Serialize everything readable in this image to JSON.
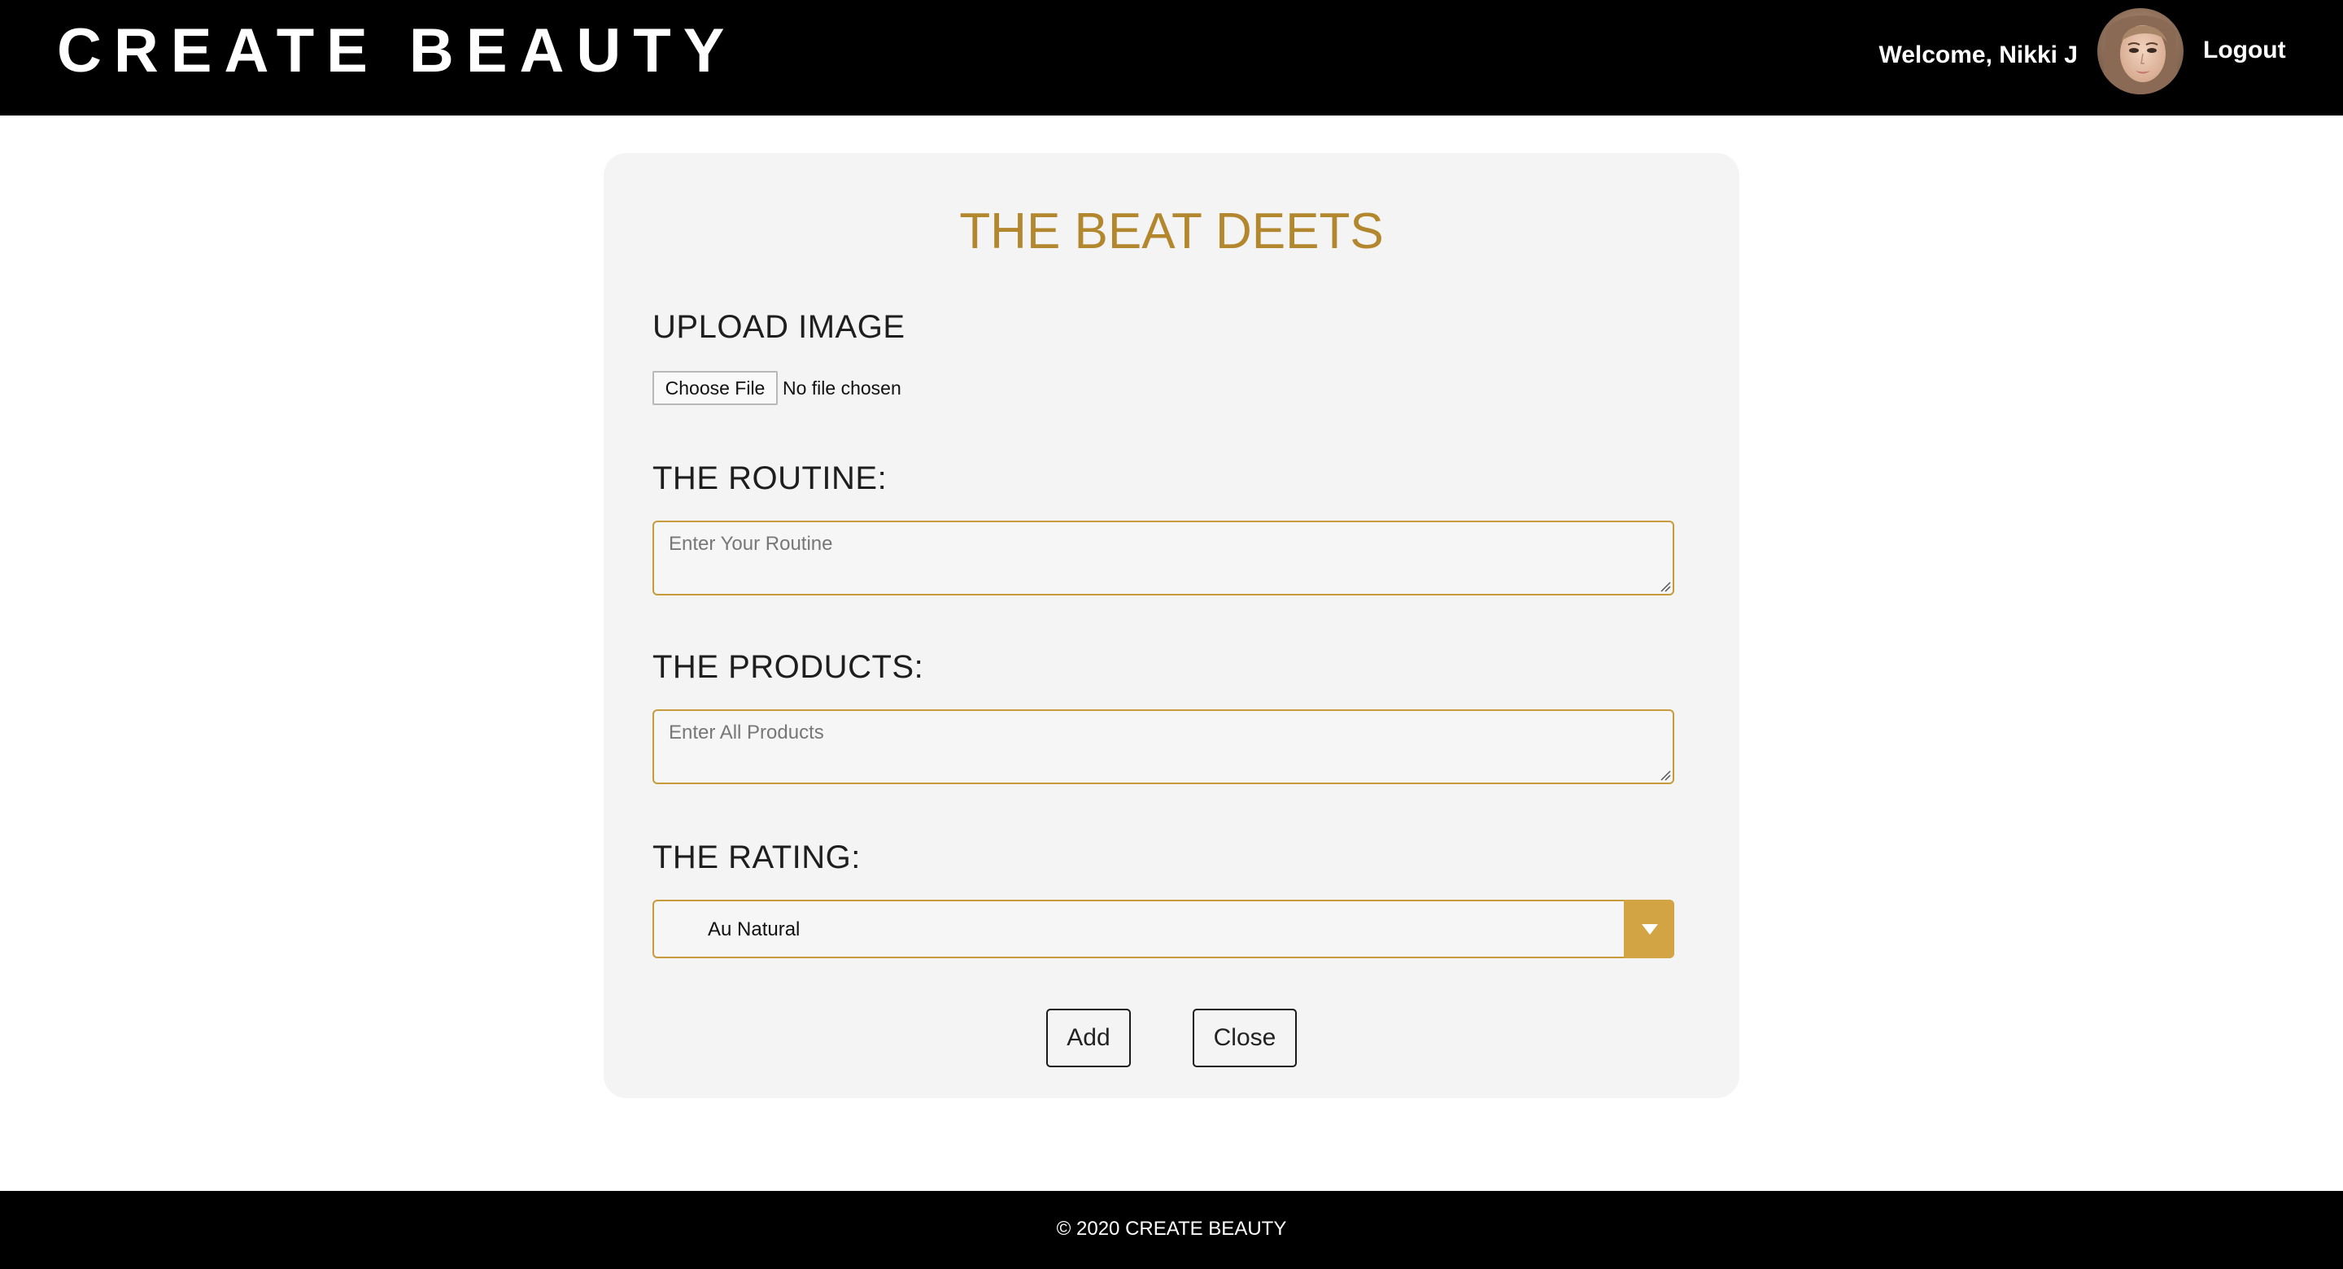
{
  "header": {
    "brand": "CREATE BEAUTY",
    "welcome_text": "Welcome, Nikki J",
    "logout_label": "Logout",
    "avatar_icon": "user-avatar-photo"
  },
  "form": {
    "title": "THE BEAT DEETS",
    "upload": {
      "label": "UPLOAD IMAGE",
      "button_label": "Choose File",
      "status": "No file chosen"
    },
    "routine": {
      "label": "THE ROUTINE:",
      "placeholder": "Enter Your Routine",
      "value": ""
    },
    "products": {
      "label": "THE PRODUCTS:",
      "placeholder": "Enter All Products",
      "value": ""
    },
    "rating": {
      "label": "THE RATING:",
      "selected": "Au Natural",
      "icon": "chevron-down-icon"
    },
    "add_label": "Add",
    "close_label": "Close"
  },
  "footer": {
    "text": "© 2020 CREATE BEAUTY"
  },
  "colors": {
    "accent_gold": "#b2872e",
    "field_border": "#c79b3b",
    "dropdown_button": "#d3a443",
    "header_bg": "#000000",
    "card_bg": "#f4f4f4"
  }
}
